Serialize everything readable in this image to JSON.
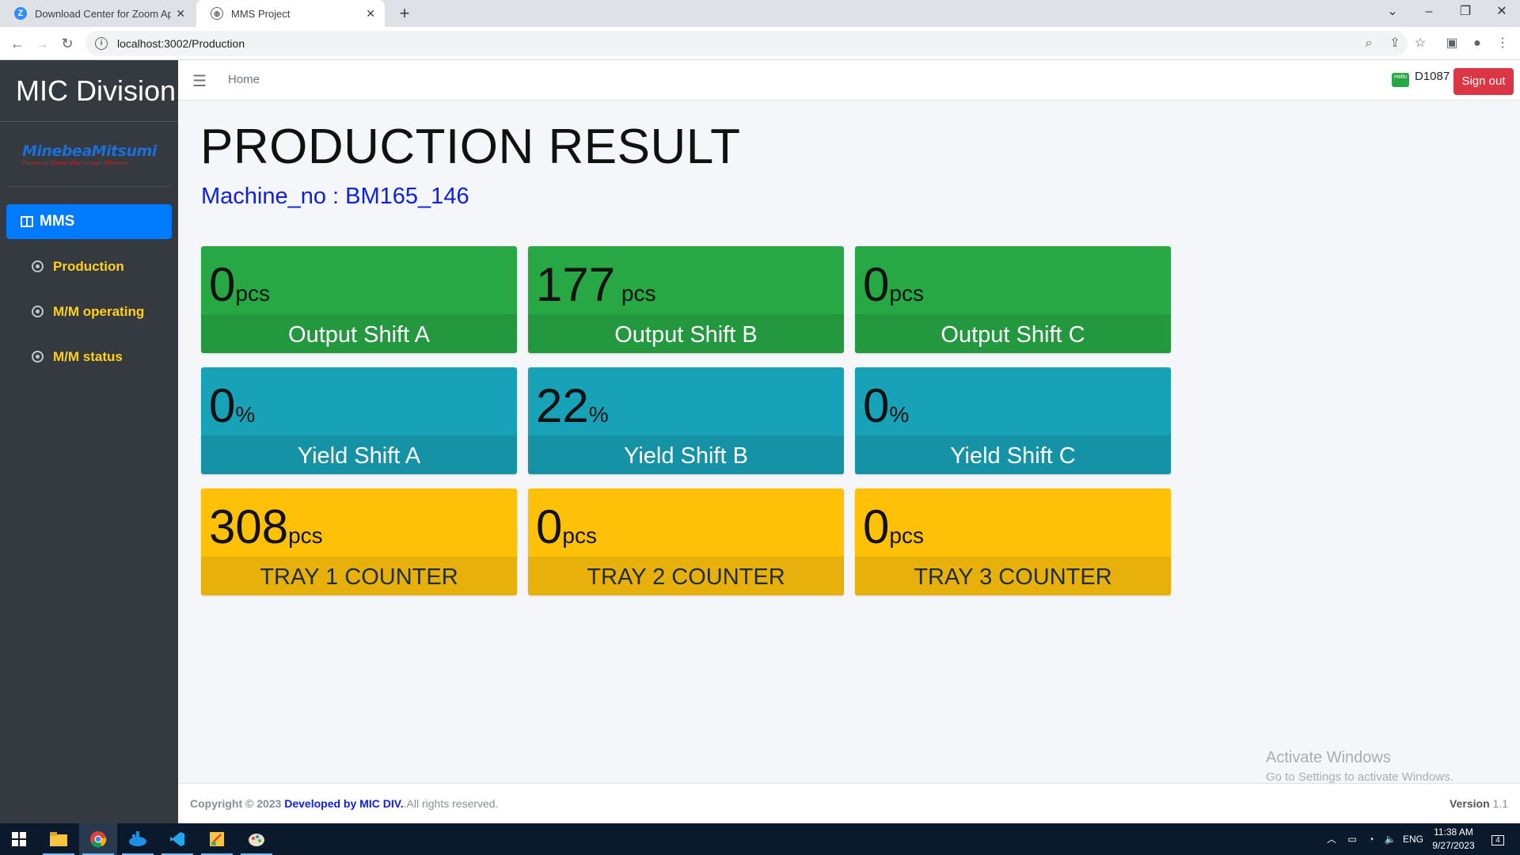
{
  "browser": {
    "tabs": [
      {
        "title": "Download Center for Zoom Apps",
        "favicon": "Z"
      },
      {
        "title": "MMS Project"
      }
    ],
    "url": "localhost:3002/Production"
  },
  "sidebar": {
    "brand": "MIC Division",
    "logo": {
      "main": "MinebeaMitsumi",
      "tagline": "Passion to Create Value through Difference"
    },
    "menu_header": "MMS",
    "items": [
      {
        "label": "Production"
      },
      {
        "label": "M/M operating"
      },
      {
        "label": "M/M status"
      }
    ]
  },
  "topnav": {
    "home_label": "Home",
    "hello_badge": "Hello",
    "user": "D1087",
    "signout_label": "Sign out"
  },
  "main": {
    "title": "PRODUCTION RESULT",
    "machine_label": "Machine_no : BM165_146",
    "cards": [
      {
        "value": "0",
        "unit": "pcs",
        "label": "Output Shift A",
        "color": "green"
      },
      {
        "value": "177",
        "unit": " pcs",
        "label": "Output Shift B",
        "color": "green"
      },
      {
        "value": "0",
        "unit": "pcs",
        "label": "Output Shift C",
        "color": "green"
      },
      {
        "value": "0",
        "unit": "%",
        "label": "Yield Shift A",
        "color": "teal"
      },
      {
        "value": "22",
        "unit": "%",
        "label": "Yield Shift B",
        "color": "teal"
      },
      {
        "value": "0",
        "unit": "%",
        "label": "Yield Shift C",
        "color": "teal"
      },
      {
        "value": "308",
        "unit": "pcs",
        "label": "TRAY 1 COUNTER",
        "color": "yellow"
      },
      {
        "value": "0",
        "unit": "pcs",
        "label": "TRAY 2 COUNTER",
        "color": "yellow"
      },
      {
        "value": "0",
        "unit": "pcs",
        "label": "TRAY 3 COUNTER",
        "color": "yellow"
      }
    ]
  },
  "watermark": {
    "line1": "Activate Windows",
    "line2": "Go to Settings to activate Windows."
  },
  "footer": {
    "copyright": "Copyright © 2023",
    "developer": "Developed by MIC DIV.",
    "rights": ".All rights reserved.",
    "version_label": "Version",
    "version_value": "1.1"
  },
  "taskbar": {
    "lang": "ENG",
    "time": "11:38 AM",
    "date": "9/27/2023",
    "notifications": "4"
  },
  "colors": {
    "sidebar_bg": "#343a40",
    "accent": "#007bff",
    "green": "#28a745",
    "teal": "#17a2b8",
    "yellow": "#ffc107",
    "signout": "#dc3545",
    "machine_text": "#0d20e0"
  }
}
